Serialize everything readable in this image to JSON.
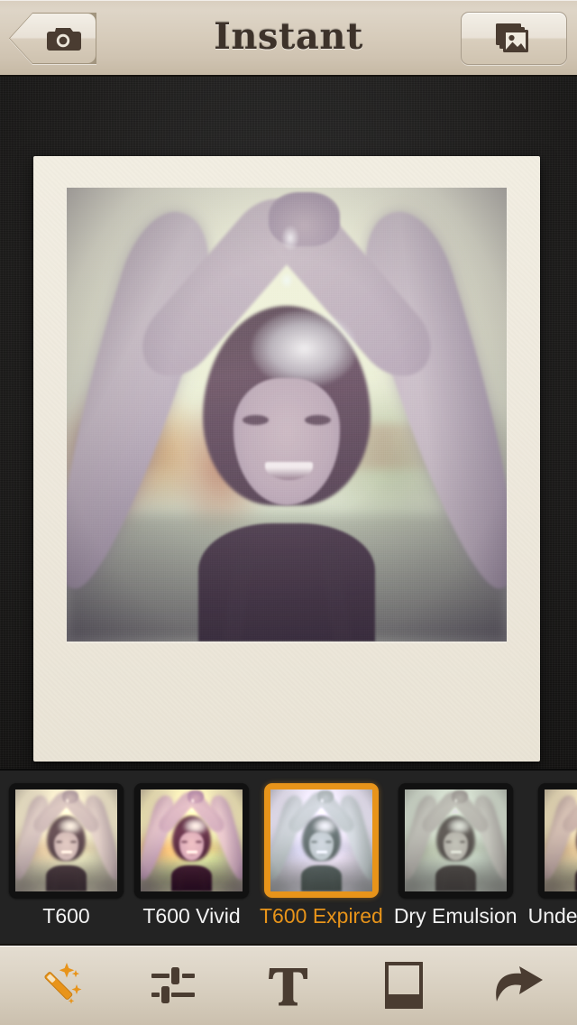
{
  "app": {
    "title": "Instant"
  },
  "navbar": {
    "title": "Instant",
    "back_button": {
      "name": "camera-button",
      "icon": "camera-icon",
      "label": "Camera"
    },
    "library_button": {
      "name": "photo-library-button",
      "icon": "photo-library-icon",
      "label": "Photo Library"
    }
  },
  "canvas": {
    "photo_alt": "Woman with arms raised having water poured over her head, vintage filtered",
    "frame_style": "polaroid",
    "applied_filter": "T600 Expired"
  },
  "filters": {
    "selected_index": 2,
    "selected_color": "#e8941a",
    "items": [
      {
        "label": "T600",
        "fx": "fx-t600",
        "selected": false
      },
      {
        "label": "T600 Vivid",
        "fx": "fx-vivid",
        "selected": false
      },
      {
        "label": "T600 Expired",
        "fx": "fx-expired",
        "selected": true
      },
      {
        "label": "Dry Emulsion",
        "fx": "fx-dry",
        "selected": false
      },
      {
        "label": "Underexposed",
        "fx": "fx-under",
        "selected": false
      }
    ]
  },
  "toolbar": {
    "items": [
      {
        "label": "Effects",
        "icon": "magic-wand-icon",
        "active": true,
        "color": "#e8941a"
      },
      {
        "label": "Adjustments",
        "icon": "sliders-icon",
        "active": false,
        "color": "#4a3c31"
      },
      {
        "label": "Text",
        "icon": "text-icon",
        "active": false,
        "color": "#4a3c31"
      },
      {
        "label": "Frame",
        "icon": "frame-icon",
        "active": false,
        "color": "#4a3c31"
      },
      {
        "label": "Share",
        "icon": "share-arrow-icon",
        "active": false,
        "color": "#4a3c31"
      }
    ]
  },
  "colors": {
    "nav_background": "#d6cbba",
    "canvas_background": "#201f1e",
    "filmstrip_background": "#232323",
    "toolbar_background": "#ded6c8",
    "accent": "#e8941a",
    "ink": "#3d322a"
  }
}
